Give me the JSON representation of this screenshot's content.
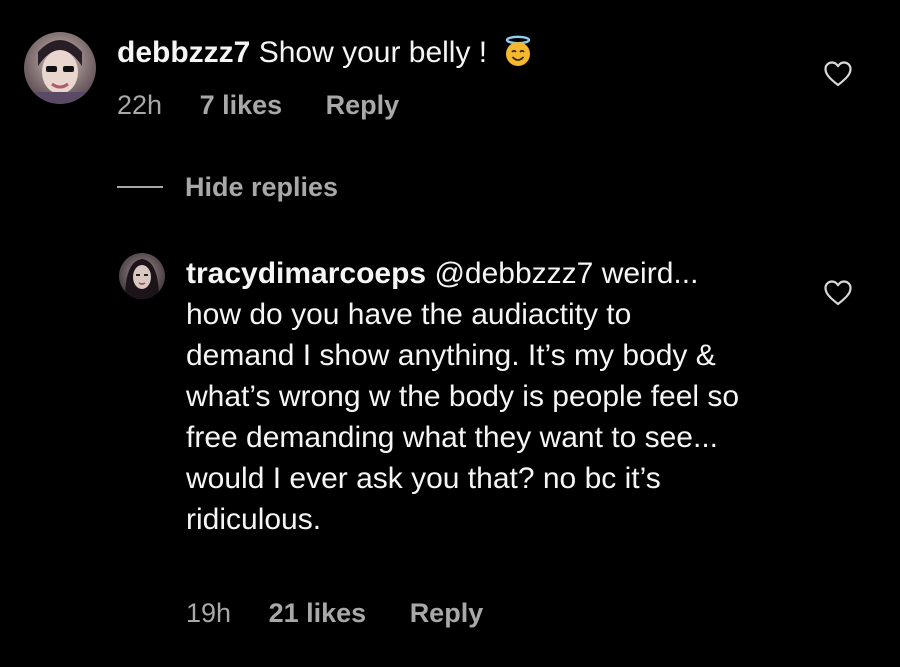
{
  "comment": {
    "username": "debbzzz7",
    "text": "Show your belly !",
    "emoji": "smiling-face-with-halo",
    "time": "22h",
    "likes": "7 likes",
    "reply_label": "Reply"
  },
  "thread": {
    "hide_replies_label": "Hide replies"
  },
  "reply": {
    "username": "tracydimarcoeps",
    "mention": "@debbzzz7",
    "text": "weird... how do you have the audiactity to demand I show anything. It’s my body & what’s wrong w the body is people feel so free demanding what they want to see... would I ever ask you that? no bc it’s ridiculous.",
    "time": "19h",
    "likes": "21 likes",
    "reply_label": "Reply"
  },
  "icons": {
    "like": "heart-outline-icon",
    "emoji_face_color": "#f5b82e",
    "halo_color": "#8fd0f0"
  },
  "colors": {
    "background": "#000000",
    "primary_text": "#f5f5f5",
    "secondary_text": "#a8a8a8"
  }
}
